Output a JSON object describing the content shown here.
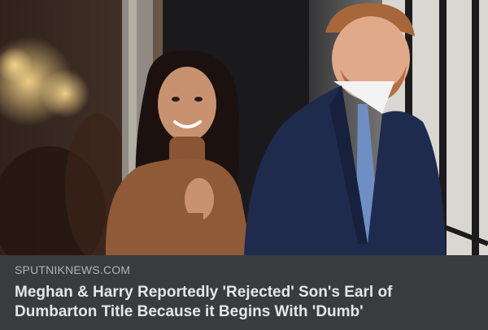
{
  "link_preview": {
    "image_alt": "Meghan and Harry in front of a building",
    "source": "SPUTNIKNEWS.COM",
    "headline": "Meghan & Harry Reportedly 'Rejected' Son's Earl of Dumbarton Title Because it Begins With 'Dumb'"
  },
  "colors": {
    "card_background": "#3a3b3c",
    "source_text": "#b0b3b8",
    "headline_text": "#e4e6eb"
  }
}
